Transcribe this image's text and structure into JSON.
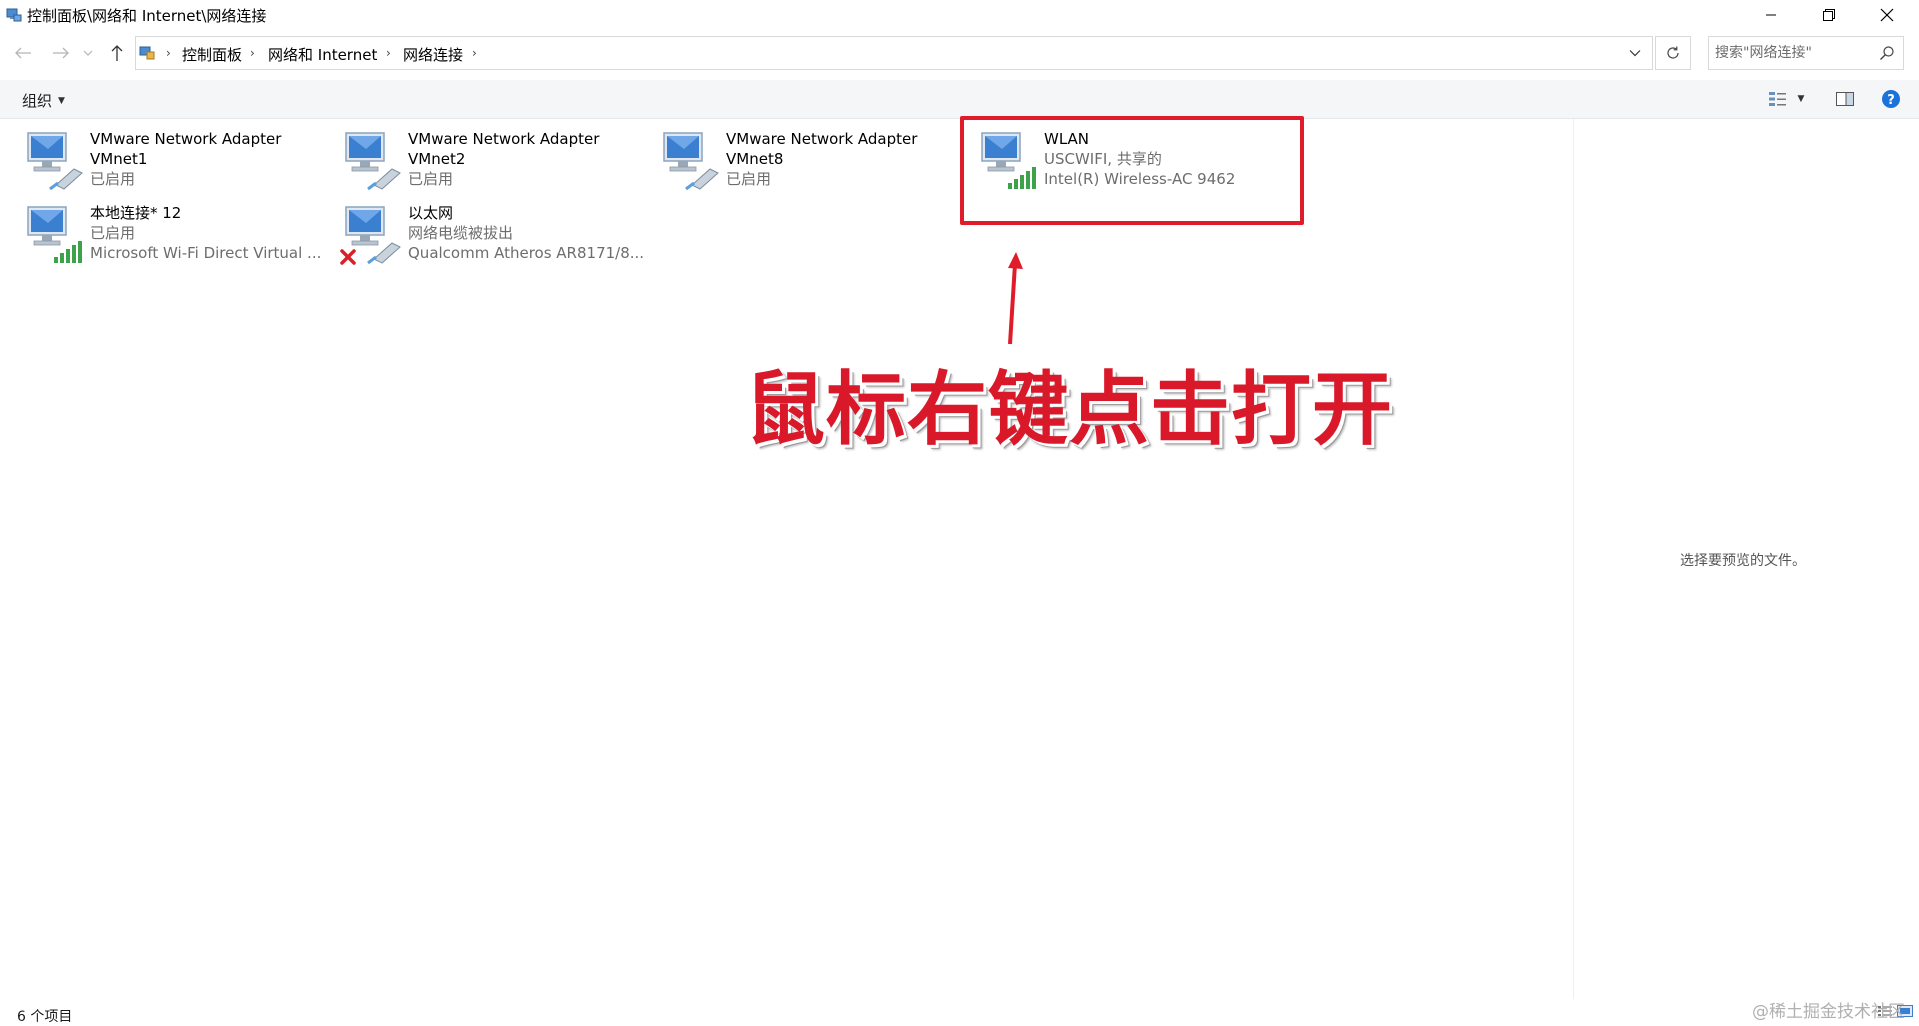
{
  "window": {
    "title": "控制面板\\网络和 Internet\\网络连接"
  },
  "breadcrumb": {
    "items": [
      "控制面板",
      "网络和 Internet",
      "网络连接"
    ]
  },
  "search": {
    "placeholder": "搜索\"网络连接\""
  },
  "toolbar": {
    "organize_label": "组织"
  },
  "connections": [
    {
      "name": "VMware Network Adapter",
      "line2": "VMnet1",
      "line3": "已启用",
      "icon": "network-adapter-icon"
    },
    {
      "name": "VMware Network Adapter",
      "line2": "VMnet2",
      "line3": "已启用",
      "icon": "network-adapter-icon"
    },
    {
      "name": "VMware Network Adapter",
      "line2": "VMnet8",
      "line3": "已启用",
      "icon": "network-adapter-icon"
    },
    {
      "name": "WLAN",
      "line2": "USCWIFI, 共享的",
      "line3": "Intel(R) Wireless-AC 9462",
      "icon": "wifi-adapter-icon"
    },
    {
      "name": "本地连接* 12",
      "line2": "已启用",
      "line3": "Microsoft Wi-Fi Direct Virtual ...",
      "icon": "wifi-adapter-icon"
    },
    {
      "name": "以太网",
      "line2": "网络电缆被拔出",
      "line3": "Qualcomm Atheros AR8171/8...",
      "icon": "ethernet-disconnected-icon"
    }
  ],
  "annotation": {
    "text": "鼠标右键点击打开",
    "color": "#d9192a"
  },
  "preview": {
    "empty_text": "选择要预览的文件。"
  },
  "status": {
    "item_count": "6 个项目"
  },
  "watermark": {
    "text": "@稀土掘金技术社区"
  }
}
